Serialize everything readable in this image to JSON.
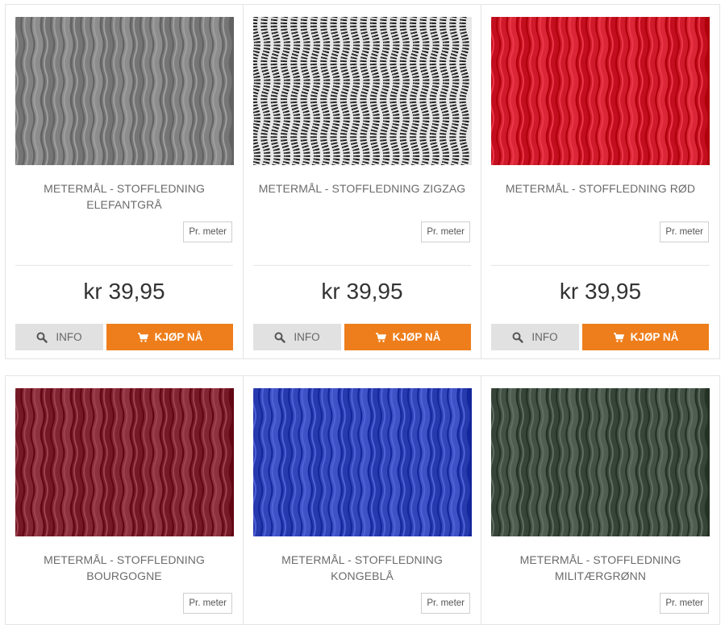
{
  "products": [
    {
      "title": "METERMÅL - STOFFLEDNING ELEFANTGRÅ",
      "unit": "Pr. meter",
      "price": "kr 39,95",
      "info": "INFO",
      "buy": "KJØP NÅ",
      "color": "#7b7b7b",
      "pattern": "plain"
    },
    {
      "title": "METERMÅL - STOFFLEDNING ZIGZAG",
      "unit": "Pr. meter",
      "price": "kr 39,95",
      "info": "INFO",
      "buy": "KJØP NÅ",
      "color": "#222222",
      "pattern": "zigzag"
    },
    {
      "title": "METERMÅL - STOFFLEDNING RØD",
      "unit": "Pr. meter",
      "price": "kr 39,95",
      "info": "INFO",
      "buy": "KJØP NÅ",
      "color": "#c81424",
      "pattern": "plain"
    },
    {
      "title": "METERMÅL - STOFFLEDNING BOURGOGNE",
      "unit": "Pr. meter",
      "color": "#7a1f2b",
      "pattern": "plain"
    },
    {
      "title": "METERMÅL - STOFFLEDNING KONGEBLÅ",
      "unit": "Pr. meter",
      "color": "#2c3fb3",
      "pattern": "plain"
    },
    {
      "title": "METERMÅL - STOFFLEDNING MILITÆRGRØNN",
      "unit": "Pr. meter",
      "color": "#3d4a3e",
      "pattern": "plain"
    }
  ]
}
